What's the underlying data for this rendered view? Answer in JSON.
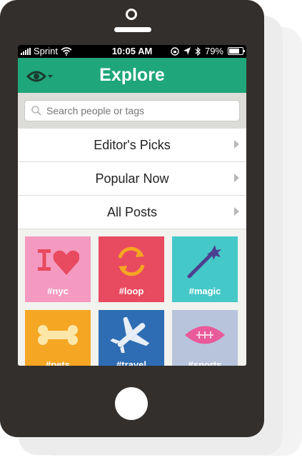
{
  "status_bar": {
    "carrier": "Sprint",
    "time": "10:05 AM",
    "battery": "79%",
    "battery_level": 0.79
  },
  "nav": {
    "title": "Explore",
    "left_icon": "eye-icon"
  },
  "search": {
    "placeholder": "Search people or tags"
  },
  "menu": [
    {
      "label": "Editor's Picks"
    },
    {
      "label": "Popular Now"
    },
    {
      "label": "All Posts"
    }
  ],
  "tags": [
    {
      "label": "#nyc",
      "color": "#f49ac1",
      "icon": "i-heart-icon"
    },
    {
      "label": "#loop",
      "color": "#e84a5f",
      "icon": "loop-arrows-icon"
    },
    {
      "label": "#magic",
      "color": "#45c8c8",
      "icon": "magic-wand-icon"
    },
    {
      "label": "#pets",
      "color": "#f5a623",
      "icon": "bone-icon"
    },
    {
      "label": "#travel",
      "color": "#2e6db4",
      "icon": "airplane-icon"
    },
    {
      "label": "#sports",
      "color": "#b8c4dc",
      "icon": "football-icon"
    }
  ],
  "colors": {
    "accent": "#1fa67a",
    "phone_body": "#332f2c"
  }
}
